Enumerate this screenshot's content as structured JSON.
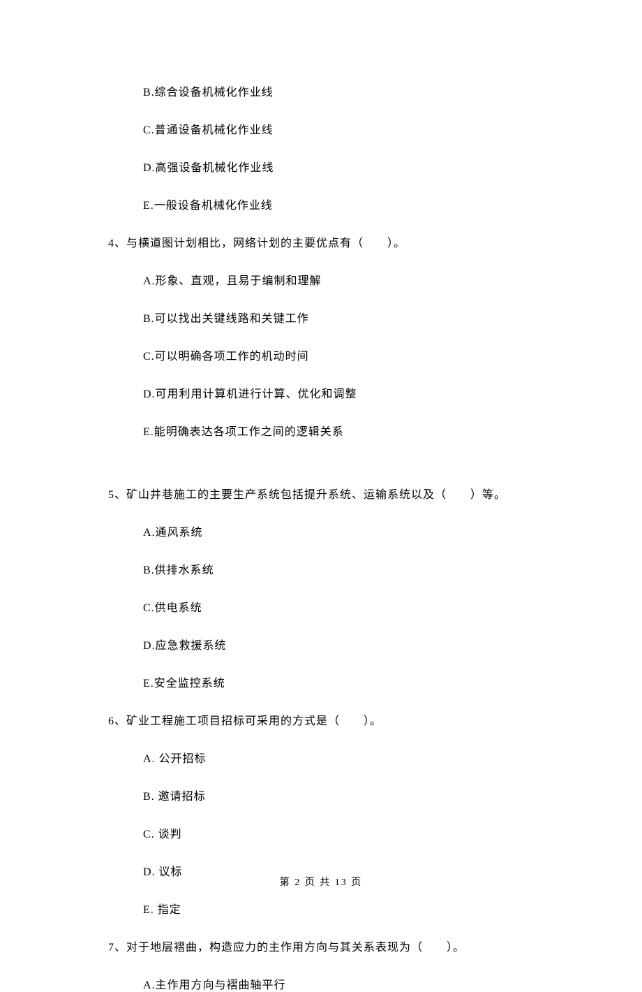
{
  "options_group1": {
    "b": "B.综合设备机械化作业线",
    "c": "C.普通设备机械化作业线",
    "d": "D.高强设备机械化作业线",
    "e": "E.一般设备机械化作业线"
  },
  "q4": {
    "stem": "4、与横道图计划相比，网络计划的主要优点有（　　）。",
    "a": "A.形象、直观，且易于编制和理解",
    "b": "B.可以找出关键线路和关键工作",
    "c": "C.可以明确各项工作的机动时间",
    "d": "D.可用利用计算机进行计算、优化和调整",
    "e": "E.能明确表达各项工作之间的逻辑关系"
  },
  "q5": {
    "stem": "5、矿山井巷施工的主要生产系统包括提升系统、运输系统以及（　　）等。",
    "a": "A.通风系统",
    "b": "B.供排水系统",
    "c": "C.供电系统",
    "d": "D.应急救援系统",
    "e": "E.安全监控系统"
  },
  "q6": {
    "stem": "6、矿业工程施工项目招标可采用的方式是（　　）。",
    "a": "A.  公开招标",
    "b": "B.  邀请招标",
    "c": "C.  谈判",
    "d": "D.  议标",
    "e": "E.  指定"
  },
  "q7": {
    "stem": "7、对于地层褶曲，构造应力的主作用方向与其关系表现为（　　）。",
    "a": "A.主作用方向与褶曲轴平行"
  },
  "footer": "第 2 页 共 13 页"
}
